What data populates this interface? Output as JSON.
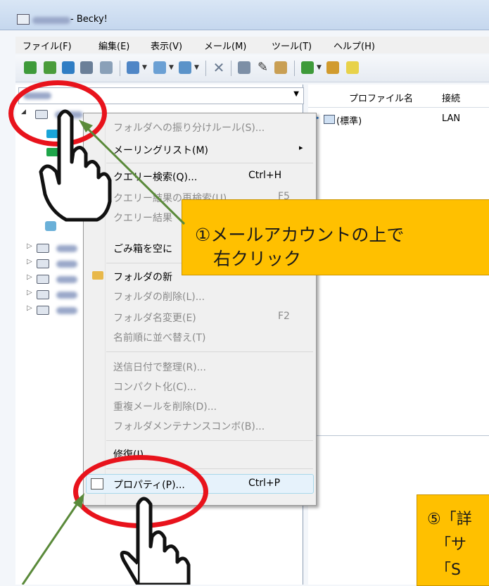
{
  "window": {
    "title": " - Becky!"
  },
  "menubar": [
    "ファイル(F)",
    "編集(E)",
    "表示(V)",
    "メール(M)",
    "ツール(T)",
    "ヘルプ(H)"
  ],
  "right_pane": {
    "columns": [
      "プロファイル名",
      "接続"
    ],
    "row": {
      "name": "(標準)",
      "connection": "LAN"
    }
  },
  "context_menu": {
    "items": [
      {
        "label": "フォルダへの振り分けルール(S)...",
        "enabled": false
      },
      {
        "label": "メーリングリスト(M)",
        "enabled": true,
        "submenu": "▸"
      },
      {
        "label": "クエリー検索(Q)...",
        "shortcut": "Ctrl+H",
        "enabled": true
      },
      {
        "label": "クエリー結果の再検索(U)",
        "shortcut": "F5",
        "enabled": false
      },
      {
        "label": "クエリー結果",
        "enabled": false
      },
      {
        "label": "ごみ箱を空に",
        "enabled": true
      },
      {
        "label": "フォルダの新",
        "enabled": true
      },
      {
        "label": "フォルダの削除(L)...",
        "enabled": false
      },
      {
        "label": "フォルダ名変更(E)",
        "shortcut": "F2",
        "enabled": false
      },
      {
        "label": "名前順に並べ替え(T)",
        "enabled": false
      },
      {
        "label": "送信日付で整理(R)...",
        "enabled": false
      },
      {
        "label": "コンパクト化(C)...",
        "enabled": false
      },
      {
        "label": "重複メールを削除(D)...",
        "enabled": false
      },
      {
        "label": "フォルダメンテナンスコンボ(B)...",
        "enabled": false
      },
      {
        "label": "修復(I)",
        "enabled": true
      },
      {
        "label": "プロパティ(P)...",
        "shortcut": "Ctrl+P",
        "enabled": true
      }
    ]
  },
  "callouts": {
    "step1_line1": "①メールアカウントの上で",
    "step1_line2": "右クリック",
    "step5_line1": "⑤「詳",
    "step5_line2": "「サ",
    "step5_line3": "「S"
  },
  "colors": {
    "callout": "#ffc000",
    "ring": "#e8131c",
    "arrow": "#5a8a3a"
  }
}
